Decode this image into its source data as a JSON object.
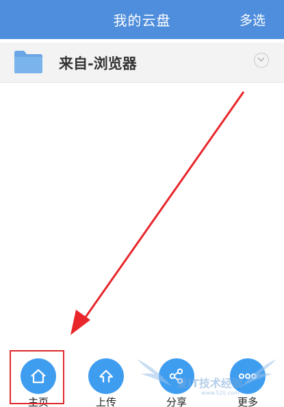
{
  "header": {
    "title": "我的云盘",
    "action_label": "多选"
  },
  "files": [
    {
      "name": "来自-浏览器",
      "icon": "folder-icon"
    }
  ],
  "toolbar": {
    "items": [
      {
        "label": "主页",
        "icon": "home-icon"
      },
      {
        "label": "上传",
        "icon": "upload-icon"
      },
      {
        "label": "分享",
        "icon": "share-icon"
      },
      {
        "label": "更多",
        "icon": "more-icon"
      }
    ]
  },
  "annotation": {
    "highlighted_item": "主页",
    "arrow_color": "#e8262b",
    "box_color": "#e0262b"
  },
  "watermark": {
    "text": "爱IT技术经验",
    "subtext": "www.52ij.com"
  },
  "colors": {
    "header_bg": "#4f8edc",
    "accent": "#3f9df0",
    "folder": "#6aa6e6"
  }
}
